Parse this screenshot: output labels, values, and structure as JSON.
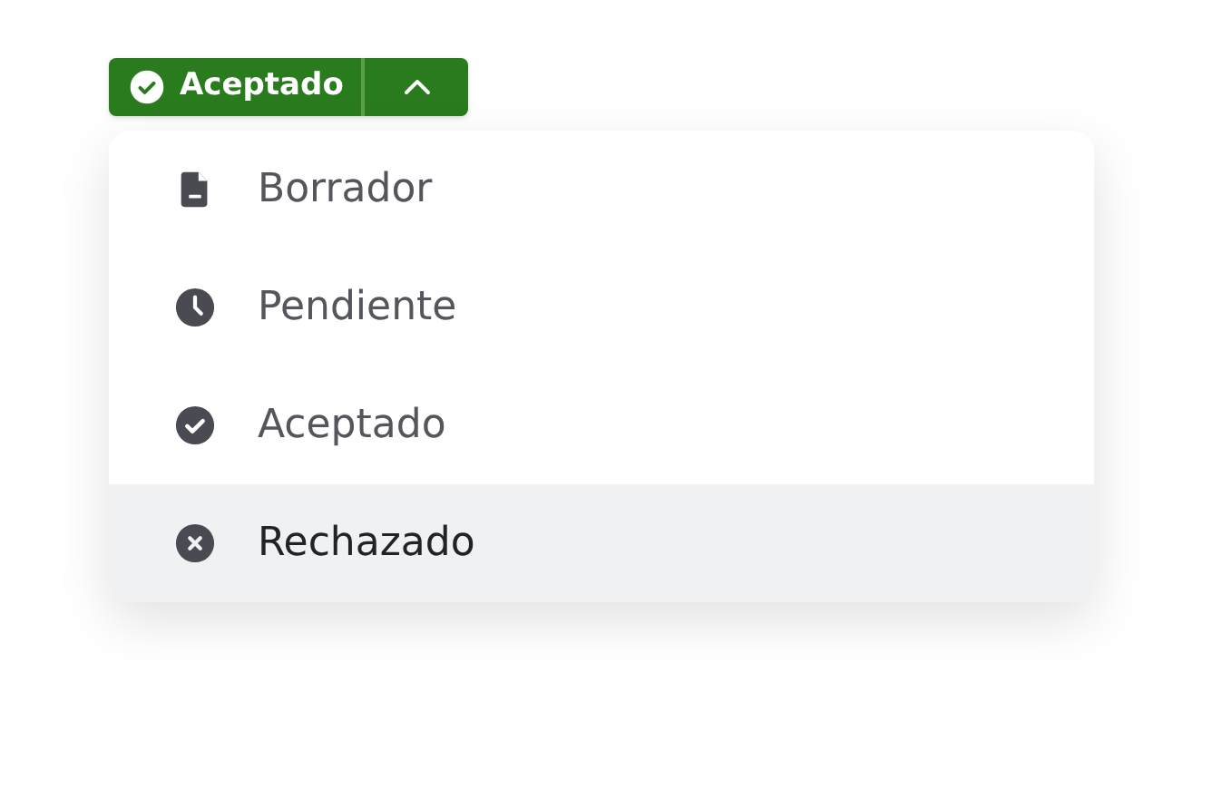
{
  "status_button": {
    "label": "Aceptado",
    "kind": "accepted",
    "expanded": true
  },
  "menu": {
    "items": [
      {
        "label": "Borrador",
        "kind": "draft",
        "highlighted": false
      },
      {
        "label": "Pendiente",
        "kind": "pending",
        "highlighted": false
      },
      {
        "label": "Aceptado",
        "kind": "accepted",
        "highlighted": false
      },
      {
        "label": "Rechazado",
        "kind": "rejected",
        "highlighted": true
      }
    ]
  }
}
